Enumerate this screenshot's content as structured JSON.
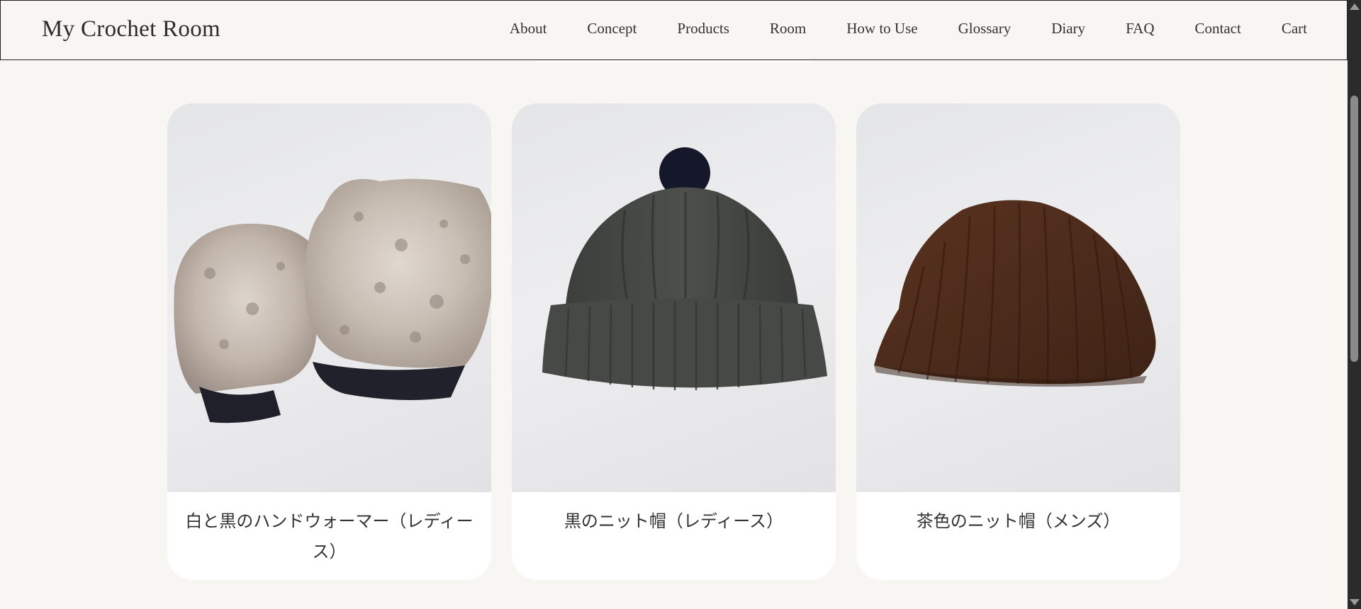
{
  "site": {
    "brand": "My Crochet Room"
  },
  "nav": {
    "items": [
      {
        "label": "About",
        "name": "nav-about"
      },
      {
        "label": "Concept",
        "name": "nav-concept"
      },
      {
        "label": "Products",
        "name": "nav-products"
      },
      {
        "label": "Room",
        "name": "nav-room"
      },
      {
        "label": "How to Use",
        "name": "nav-how-to-use"
      },
      {
        "label": "Glossary",
        "name": "nav-glossary"
      },
      {
        "label": "Diary",
        "name": "nav-diary"
      },
      {
        "label": "FAQ",
        "name": "nav-faq"
      },
      {
        "label": "Contact",
        "name": "nav-contact"
      },
      {
        "label": "Cart",
        "name": "nav-cart"
      }
    ]
  },
  "products": [
    {
      "title": "白と黒のハンドウォーマー（レディース）",
      "image": "white-black-fur-hand-warmers"
    },
    {
      "title": "黒のニット帽（レディース）",
      "image": "black-knit-hat-with-pompom"
    },
    {
      "title": "茶色のニット帽（メンズ）",
      "image": "brown-ribbed-knit-hat"
    }
  ],
  "colors": {
    "background": "#f7f6f2",
    "card": "#ffffff",
    "text": "#2b2b2b",
    "scrollbar": "#2b2b2b"
  }
}
